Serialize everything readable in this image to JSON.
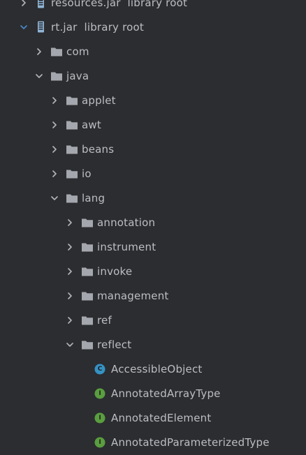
{
  "tree": {
    "rows": [
      {
        "label": "resources.jar  library root",
        "icon": "jar-icon",
        "expanded": false,
        "depth": 0
      },
      {
        "label": "rt.jar  library root",
        "icon": "jar-icon",
        "expanded": true,
        "depth": 0
      },
      {
        "label": "com",
        "icon": "folder-icon",
        "expanded": false,
        "depth": 1
      },
      {
        "label": "java",
        "icon": "folder-icon",
        "expanded": true,
        "depth": 1
      },
      {
        "label": "applet",
        "icon": "folder-icon",
        "expanded": false,
        "depth": 2
      },
      {
        "label": "awt",
        "icon": "folder-icon",
        "expanded": false,
        "depth": 2
      },
      {
        "label": "beans",
        "icon": "folder-icon",
        "expanded": false,
        "depth": 2
      },
      {
        "label": "io",
        "icon": "folder-icon",
        "expanded": false,
        "depth": 2
      },
      {
        "label": "lang",
        "icon": "folder-icon",
        "expanded": true,
        "depth": 2
      },
      {
        "label": "annotation",
        "icon": "folder-icon",
        "expanded": false,
        "depth": 3
      },
      {
        "label": "instrument",
        "icon": "folder-icon",
        "expanded": false,
        "depth": 3
      },
      {
        "label": "invoke",
        "icon": "folder-icon",
        "expanded": false,
        "depth": 3
      },
      {
        "label": "management",
        "icon": "folder-icon",
        "expanded": false,
        "depth": 3
      },
      {
        "label": "ref",
        "icon": "folder-icon",
        "expanded": false,
        "depth": 3
      },
      {
        "label": "reflect",
        "icon": "folder-icon",
        "expanded": true,
        "depth": 3
      },
      {
        "label": "AccessibleObject",
        "icon": "class-icon",
        "badge": "C",
        "depth": 4
      },
      {
        "label": "AnnotatedArrayType",
        "icon": "interface-icon",
        "badge": "I",
        "depth": 4
      },
      {
        "label": "AnnotatedElement",
        "icon": "interface-icon",
        "badge": "I",
        "depth": 4
      },
      {
        "label": "AnnotatedParameterizedType",
        "icon": "interface-icon",
        "badge": "I",
        "depth": 4
      }
    ]
  },
  "colors": {
    "background": "#2b2d30",
    "text": "#bcbec4",
    "chevron": "#b0b3b8",
    "chevron_expanded_root": "#4a88c7",
    "folder": "#a4a7ad",
    "jar": "#8fb4d6",
    "class_badge": "#3592c4",
    "interface_badge": "#5a9e3f"
  }
}
